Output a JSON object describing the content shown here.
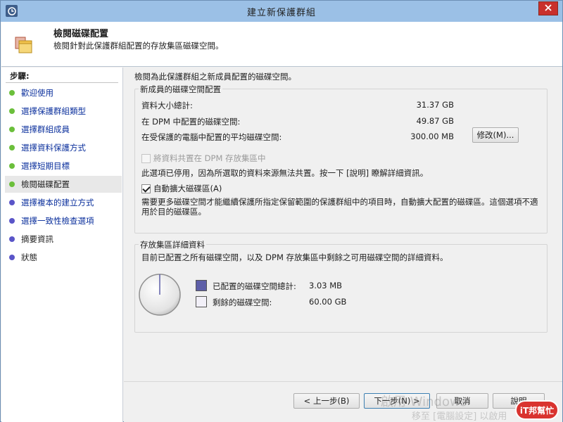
{
  "window": {
    "title": "建立新保護群組"
  },
  "header": {
    "title": "檢閱磁碟配置",
    "subtitle": "檢閱針對此保護群組配置的存放集區磁碟空間。"
  },
  "sidebar": {
    "title": "步驟:",
    "items": [
      {
        "label": "歡迎使用",
        "dot": "#6bbf3b",
        "link": true
      },
      {
        "label": "選擇保護群組類型",
        "dot": "#6bbf3b",
        "link": true
      },
      {
        "label": "選擇群組成員",
        "dot": "#6bbf3b",
        "link": true
      },
      {
        "label": "選擇資料保護方式",
        "dot": "#6bbf3b",
        "link": true
      },
      {
        "label": "選擇短期目標",
        "dot": "#6bbf3b",
        "link": true
      },
      {
        "label": "檢閱磁碟配置",
        "dot": "#6bbf3b",
        "link": false
      },
      {
        "label": "選擇複本的建立方式",
        "dot": "#5a55c8",
        "link": true
      },
      {
        "label": "選擇一致性檢查選項",
        "dot": "#5a55c8",
        "link": true
      },
      {
        "label": "摘要資訊",
        "dot": "#5a55c8",
        "link": false
      },
      {
        "label": "狀態",
        "dot": "#5a55c8",
        "link": false
      }
    ]
  },
  "main": {
    "intro": "檢閱為此保護群組之新成員配置的磁碟空間。",
    "allocation": {
      "legend": "新成員的磁碟空間配置",
      "rows": [
        {
          "label": "資料大小總計:",
          "value": "31.37 GB"
        },
        {
          "label": "在 DPM 中配置的磁碟空間:",
          "value": "49.87 GB"
        },
        {
          "label": "在受保護的電腦中配置的平均磁碟空間:",
          "value": "300.00 MB"
        }
      ],
      "modify_button": "修改(M)...",
      "colocate_label": "將資料共置在 DPM 存放集區中",
      "colocate_note": "此選項已停用，因為所選取的資料來源無法共置。按一下 [說明] 瞭解詳細資訊。",
      "autogrow_label": "自動擴大磁碟區(A)",
      "autogrow_note": "需要更多磁碟空間才能繼續保護所指定保留範圍的保護群組中的項目時，自動擴大配置的磁碟區。這個選項不適用於目的磁碟區。"
    },
    "storage": {
      "legend": "存放集區詳細資料",
      "description": "目前已配置之所有磁碟空間，以及 DPM 存放集區中剩餘之可用磁碟空間的詳細資料。",
      "allocated_label": "已配置的磁碟空間總計:",
      "allocated_value": "3.03 MB",
      "allocated_color": "#5e5fa8",
      "remaining_label": "剩餘的磁碟空間:",
      "remaining_value": "60.00 GB",
      "remaining_color": "#f2f0f8"
    }
  },
  "buttons": {
    "back": "< 上一步(B)",
    "next": "下一步(N) >",
    "cancel": "取消",
    "help": "說明"
  },
  "watermark": "啟用 Windows",
  "watermark2": "移至 [電腦設定] 以啟用",
  "logo": "iT邦幫忙"
}
